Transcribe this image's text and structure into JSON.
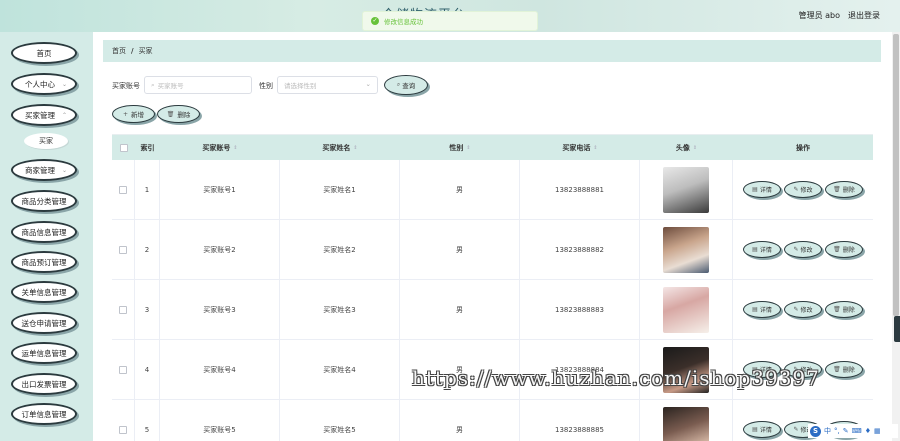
{
  "header": {
    "title": "仓储物流平台",
    "user": "管理员 abo",
    "logout": "退出登录"
  },
  "toast": {
    "text": "修改信息成功"
  },
  "sidebar": {
    "items": [
      {
        "label": "首页"
      },
      {
        "label": "个人中心"
      },
      {
        "label": "买家管理"
      },
      {
        "label": "商家管理"
      },
      {
        "label": "商品分类管理"
      },
      {
        "label": "商品信息管理"
      },
      {
        "label": "商品预订管理"
      },
      {
        "label": "关单信息管理"
      },
      {
        "label": "送仓申请管理"
      },
      {
        "label": "运单信息管理"
      },
      {
        "label": "出口发票管理"
      },
      {
        "label": "订单信息管理"
      }
    ],
    "subitem": "买家"
  },
  "breadcrumb": {
    "home": "首页",
    "sep": "/",
    "current": "买家"
  },
  "search": {
    "account_label": "买家账号",
    "account_placeholder": "买家账号",
    "gender_label": "性别",
    "gender_placeholder": "请选择性别",
    "query_label": "查询"
  },
  "actions": {
    "add": "新增",
    "delete": "删除"
  },
  "table": {
    "headers": [
      "索引",
      "买家账号",
      "买家姓名",
      "性别",
      "买家电话",
      "头像",
      "操作"
    ],
    "rows": [
      {
        "index": "1",
        "account": "买家账号1",
        "name": "买家姓名1",
        "gender": "男",
        "phone": "13823888881"
      },
      {
        "index": "2",
        "account": "买家账号2",
        "name": "买家姓名2",
        "gender": "男",
        "phone": "13823888882"
      },
      {
        "index": "3",
        "account": "买家账号3",
        "name": "买家姓名3",
        "gender": "男",
        "phone": "13823888883"
      },
      {
        "index": "4",
        "account": "买家账号4",
        "name": "买家姓名4",
        "gender": "男",
        "phone": "13823888884"
      },
      {
        "index": "5",
        "account": "买家账号5",
        "name": "买家姓名5",
        "gender": "男",
        "phone": "13823888885"
      }
    ],
    "ops": {
      "detail": "详情",
      "edit": "修改",
      "delete": "删除"
    }
  },
  "watermark": "https://www.huzhan.com/ishop39397",
  "colors": {
    "accent": "#d4ebe7",
    "border": "#2b3a3e",
    "success": "#67c23a"
  }
}
